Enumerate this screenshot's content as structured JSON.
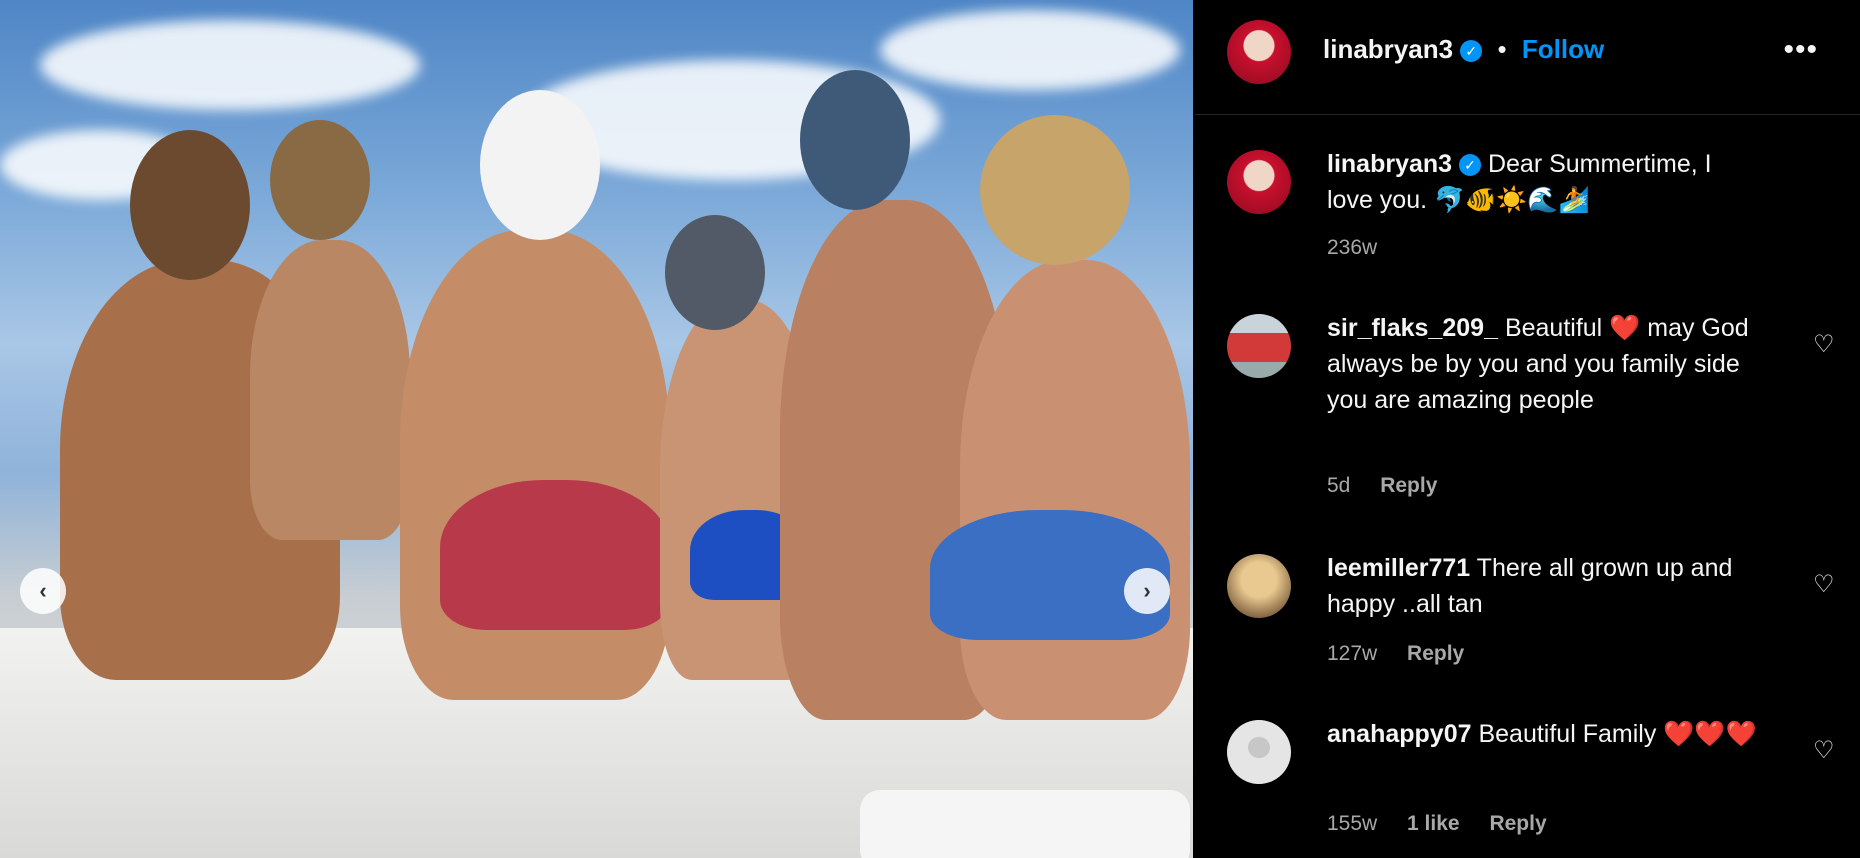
{
  "post": {
    "username": "linabryan3",
    "follow_label": "Follow",
    "separator": "•",
    "more_icon": "more-horizontal-icon",
    "caption_user": "linabryan3",
    "caption_text": "Dear Summertime, I love you. 🐬🐠☀️🌊🏄",
    "caption_time": "236w"
  },
  "comments": [
    {
      "user": "sir_flaks_209_",
      "text": "Beautiful ❤️ may God always be by you and you family side you are amazing people",
      "time": "5d",
      "likes": "",
      "reply": "Reply"
    },
    {
      "user": "leemiller771",
      "text": "There all grown up and happy ..all tan",
      "time": "127w",
      "likes": "",
      "reply": "Reply"
    },
    {
      "user": "anahappy07",
      "text": "Beautiful Family ❤️❤️❤️",
      "time": "155w",
      "likes": "1 like",
      "reply": "Reply"
    }
  ],
  "nav": {
    "prev_icon": "chevron-left-icon",
    "next_icon": "chevron-right-icon"
  },
  "colors": {
    "link": "#0095f6",
    "background": "#000000",
    "muted": "#a8a8a8"
  }
}
